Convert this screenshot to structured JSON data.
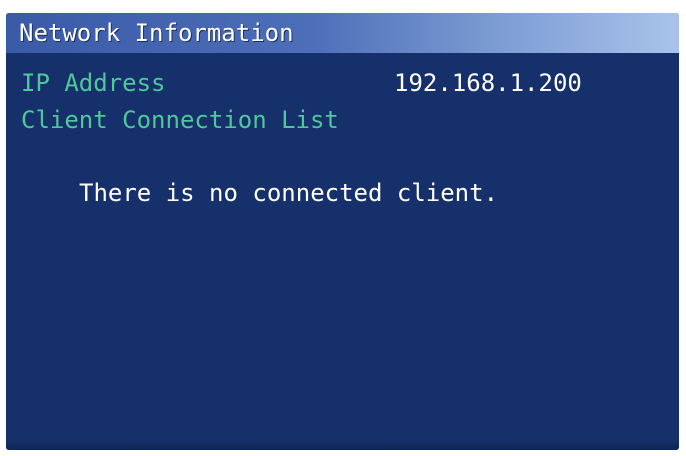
{
  "window": {
    "title": "Network Information"
  },
  "network": {
    "ip_label": "IP Address",
    "ip_value": "192.168.1.200",
    "client_list_label": "Client Connection List",
    "empty_message": "There is no connected client."
  },
  "colors": {
    "background": "#15306a",
    "title_bar": "#4d6eb8",
    "label_green": "#4fc79a",
    "text_white": "#ffffff"
  }
}
